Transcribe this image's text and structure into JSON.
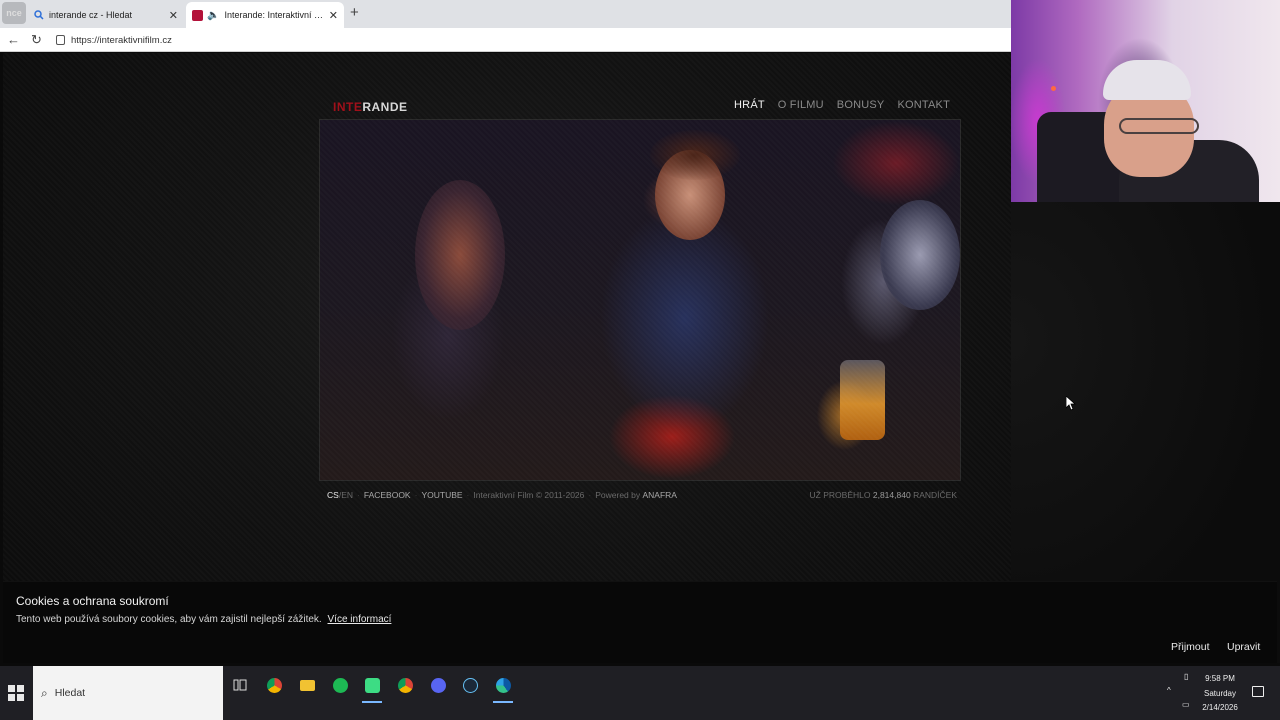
{
  "browser": {
    "tabs": [
      {
        "title": "interande cz - Hledat",
        "close": "✕"
      },
      {
        "title": "Interande: Interaktivní film, cool",
        "close": "✕"
      }
    ],
    "new_tab": "+",
    "url": "https://interaktivnifilm.cz",
    "tab_overlay": "nce"
  },
  "site": {
    "logo_red": "INTE",
    "logo_white": "RANDE",
    "nav": [
      "HRÁT",
      "O FILMU",
      "BONUSY",
      "KONTAKT"
    ],
    "footer": {
      "lang_cs": "CS",
      "lang_sep": "/",
      "lang_en": "EN",
      "facebook": "FACEBOOK",
      "youtube": "YOUTUBE",
      "copyright": "Interaktivní Film © 2011-2026",
      "powered_prefix": "Powered by",
      "powered_by": "ANAFRA",
      "counter_prefix": "UŽ PROBĚHLO",
      "counter_value": "2,814,840",
      "counter_suffix": "RANDÍČEK"
    }
  },
  "cookie_banner": {
    "title": "Cookies a ochrana soukromí",
    "text": "Tento web používá soubory cookies, aby vám zajistil nejlepší zážitek.",
    "link": "Více informací",
    "accept": "Přijmout",
    "edit": "Upravit"
  },
  "taskbar": {
    "search_placeholder": "Hledat",
    "time": "9:58 PM",
    "day": "Saturday",
    "date": "2/14/2026",
    "apps": [
      "chrome-icon",
      "file-explorer-icon",
      "spotify-icon",
      "android-icon",
      "chrome-icon",
      "discord-icon",
      "steam-icon",
      "edge-icon"
    ]
  },
  "colors": {
    "logo_red": "#a0101a",
    "page_bg": "#121212",
    "taskbar_bg": "#1f1f24"
  }
}
